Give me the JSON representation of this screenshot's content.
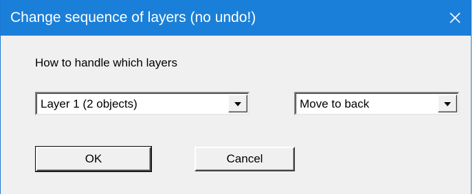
{
  "window": {
    "title": "Change sequence of layers (no undo!)",
    "close_icon": "close-icon",
    "titlebar_color": "#1a7fd8"
  },
  "dialog": {
    "instruction_label": "How to handle which layers",
    "layer_select": {
      "selected": "Layer  1  (2 objects)"
    },
    "action_select": {
      "selected": "Move to back"
    },
    "ok_label": "OK",
    "cancel_label": "Cancel"
  }
}
